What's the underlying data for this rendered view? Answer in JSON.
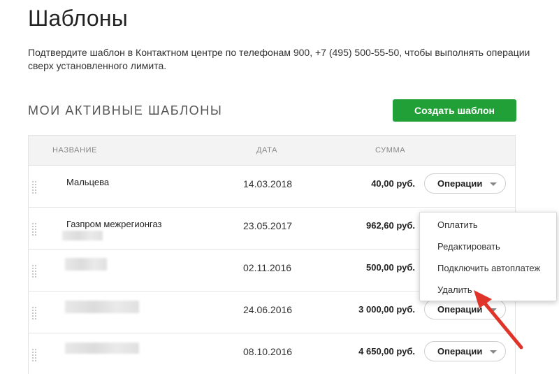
{
  "page": {
    "title": "Шаблоны",
    "intro": "Подтвердите шаблон в Контактном центре по телефонам 900, +7 (495) 500-55-50, чтобы выполнять операции сверх установленного лимита."
  },
  "section": {
    "title": "МОИ АКТИВНЫЕ ШАБЛОНЫ",
    "create_label": "Создать шаблон"
  },
  "table": {
    "headers": {
      "name": "НАЗВАНИЕ",
      "date": "ДАТА",
      "sum": "СУММА"
    },
    "rows": [
      {
        "name": "Мальцева",
        "date": "14.03.2018",
        "sum": "40,00 руб.",
        "ops_label": "Операции"
      },
      {
        "name": "Газпром межрегионгаз",
        "date": "23.05.2017",
        "sum": "962,60 руб.",
        "ops_label": "Операции"
      },
      {
        "name": "",
        "date": "02.11.2016",
        "sum": "500,00 руб.",
        "ops_label": "Операции"
      },
      {
        "name": "",
        "date": "24.06.2016",
        "sum": "3 000,00 руб.",
        "ops_label": "Операции"
      },
      {
        "name": "",
        "date": "08.10.2016",
        "sum": "4 650,00 руб.",
        "ops_label": "Операции"
      }
    ]
  },
  "dropdown": {
    "items": [
      "Оплатить",
      "Редактировать",
      "Подключить автоплатеж",
      "Удалить"
    ]
  },
  "colors": {
    "accent": "#22a038",
    "annotation_arrow": "#e0342a"
  }
}
